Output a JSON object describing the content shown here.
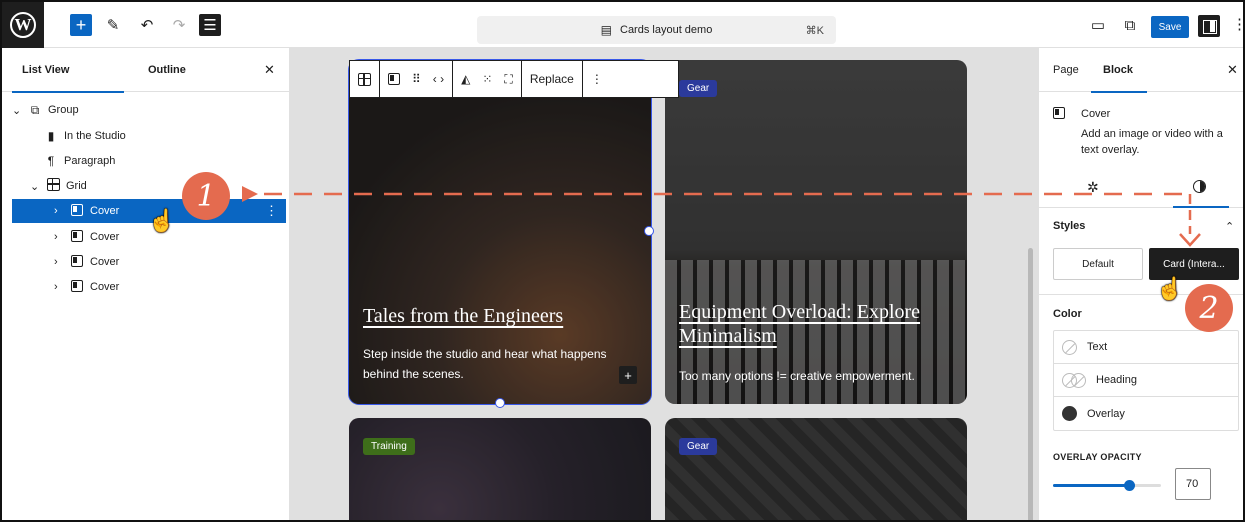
{
  "topbar": {
    "logo_label": "W",
    "add_icon": "plus-icon",
    "doc_title": "Cards layout demo",
    "shortcut": "⌘K",
    "save_label": "Save"
  },
  "list_view": {
    "tab_list": "List View",
    "tab_outline": "Outline",
    "items": [
      {
        "label": "Group",
        "chevron": "⌄",
        "indent": 0,
        "icon": "group-icon"
      },
      {
        "label": "In the Studio",
        "chevron": "",
        "indent": 1,
        "icon": "bookmark-icon"
      },
      {
        "label": "Paragraph",
        "chevron": "",
        "indent": 1,
        "icon": "paragraph-icon"
      },
      {
        "label": "Grid",
        "chevron": "⌄",
        "indent": 1,
        "icon": "grid-icon"
      },
      {
        "label": "Cover",
        "chevron": "›",
        "indent": 2,
        "icon": "cover-icon",
        "selected": true
      },
      {
        "label": "Cover",
        "chevron": "›",
        "indent": 2,
        "icon": "cover-icon"
      },
      {
        "label": "Cover",
        "chevron": "›",
        "indent": 2,
        "icon": "cover-icon"
      },
      {
        "label": "Cover",
        "chevron": "›",
        "indent": 2,
        "icon": "cover-icon"
      }
    ]
  },
  "block_toolbar": {
    "replace_label": "Replace"
  },
  "cards": [
    {
      "title": "Tales from the Engineers",
      "desc": "Step inside the studio and hear what happens behind the scenes.",
      "badge": ""
    },
    {
      "title": "Equipment Overload: Explore Minimalism",
      "desc": "Too many options != creative empowerment.",
      "badge": "Gear"
    },
    {
      "title": "",
      "desc": "",
      "badge": "Training"
    },
    {
      "title": "",
      "desc": "",
      "badge": "Gear"
    }
  ],
  "settings": {
    "tab_page": "Page",
    "tab_block": "Block",
    "block_name": "Cover",
    "block_desc": "Add an image or video with a text overlay.",
    "styles_title": "Styles",
    "style_default": "Default",
    "style_card": "Card (Intera...",
    "color_title": "Color",
    "color_items": [
      "Text",
      "Heading",
      "Overlay"
    ],
    "opacity_label": "OVERLAY OPACITY",
    "opacity_value": "70",
    "opacity_fraction": 0.7
  },
  "annotations": {
    "step1": "1",
    "step2": "2",
    "accent": "#e46b4f"
  },
  "colors": {
    "primary": "#0a66c2",
    "dark": "#1e1e1e"
  }
}
